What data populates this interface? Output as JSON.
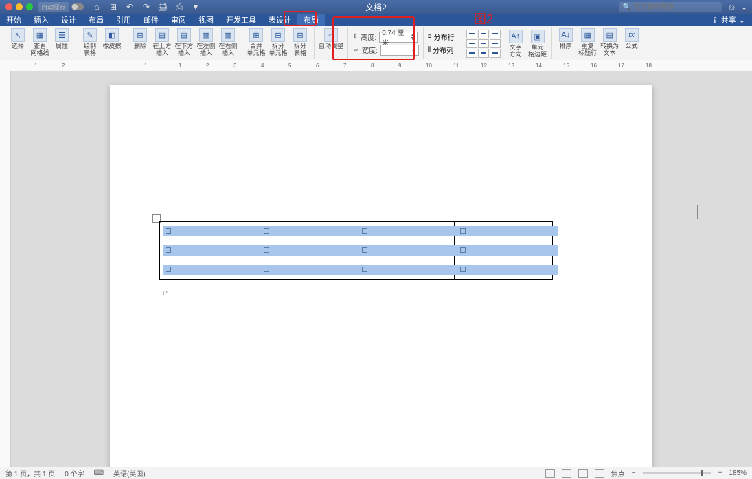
{
  "title": "文档2",
  "autosave_label": "自动保存",
  "search_placeholder": "在文档中搜索",
  "smile": "☺",
  "share_label": "共享",
  "tabs": [
    "开始",
    "插入",
    "设计",
    "布局",
    "引用",
    "邮件",
    "审阅",
    "视图",
    "开发工具",
    "表设计",
    "布局"
  ],
  "active_tab_index": 10,
  "ribbon": {
    "select": "选择",
    "gridlines": "查看\n网格线",
    "properties": "属性",
    "draw_table": "绘制\n表格",
    "eraser": "橡皮擦",
    "delete": "删除",
    "insert_above": "在上方\n插入",
    "insert_below": "在下方\n插入",
    "insert_left": "在左侧\n插入",
    "insert_right": "在右侧\n插入",
    "merge": "合并\n单元格",
    "split_cells": "拆分\n单元格",
    "split_table": "拆分\n表格",
    "autofit": "自动调整",
    "height_label": "高度:",
    "height_value": "0.74 厘米",
    "width_label": "宽度:",
    "width_value": "",
    "distribute_rows": "分布行",
    "distribute_cols": "分布列",
    "text_direction": "文字\n方向",
    "cell_margins": "单元\n格边距",
    "sort": "排序",
    "repeat_header": "重复\n标题行",
    "convert": "转换为\n文本",
    "formula": "公式",
    "fx": "fx"
  },
  "annotation_label": "图2",
  "ruler_marks": [
    "1",
    "2",
    "1",
    "1",
    "2",
    "3",
    "4",
    "5",
    "6",
    "7",
    "8",
    "9",
    "10",
    "11",
    "12",
    "13",
    "14",
    "15",
    "16",
    "17",
    "18"
  ],
  "status": {
    "page": "第 1 页，共 1 页",
    "words": "0 个字",
    "spell": "⌨",
    "language": "英语(美国)",
    "focus": "焦点",
    "zoom": "185%"
  },
  "qat": [
    "⌂",
    "⊞",
    "↶",
    "↷",
    "🖨",
    "⎙",
    "▾"
  ]
}
